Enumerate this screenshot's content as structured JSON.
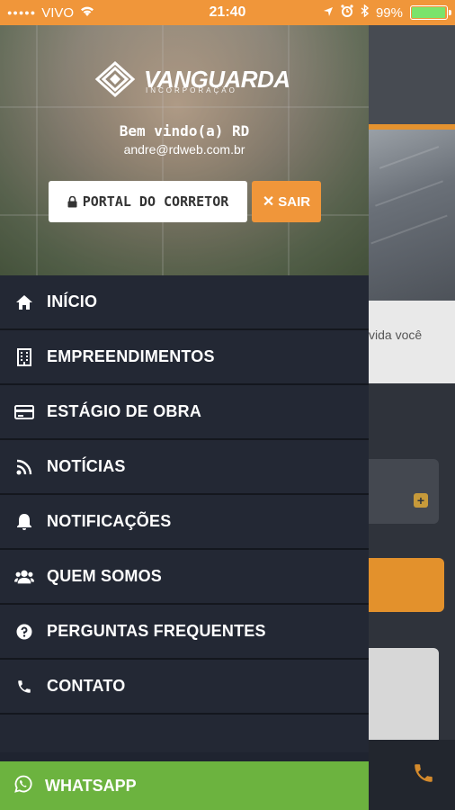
{
  "status_bar": {
    "carrier": "VIVO",
    "time": "21:40",
    "battery": "99%",
    "battery_color": "#7be36b",
    "bar_color": "#f0963a"
  },
  "drawer": {
    "brand": "VANGUARDA",
    "brand_sub": "INCORPORAÇÃO",
    "welcome": "Bem vindo(a) RD",
    "email": "andre@rdweb.com.br",
    "portal_button": "PORTAL DO CORRETOR",
    "logout_button": "SAIR",
    "accent_color": "#f0963a",
    "menu": [
      {
        "label": "INÍCIO",
        "icon": "home-icon"
      },
      {
        "label": "EMPREENDIMENTOS",
        "icon": "building-icon"
      },
      {
        "label": "ESTÁGIO DE OBRA",
        "icon": "card-icon"
      },
      {
        "label": "NOTÍCIAS",
        "icon": "rss-icon"
      },
      {
        "label": "NOTIFICAÇÕES",
        "icon": "bell-icon"
      },
      {
        "label": "QUEM SOMOS",
        "icon": "users-icon"
      },
      {
        "label": "PERGUNTAS FREQUENTES",
        "icon": "question-icon"
      },
      {
        "label": "CONTATO",
        "icon": "phone-icon"
      }
    ],
    "whatsapp": {
      "label": "WHATSAPP",
      "icon": "whatsapp-icon",
      "color": "#6cb33f"
    }
  },
  "background_page": {
    "partial_text": "vida você"
  }
}
